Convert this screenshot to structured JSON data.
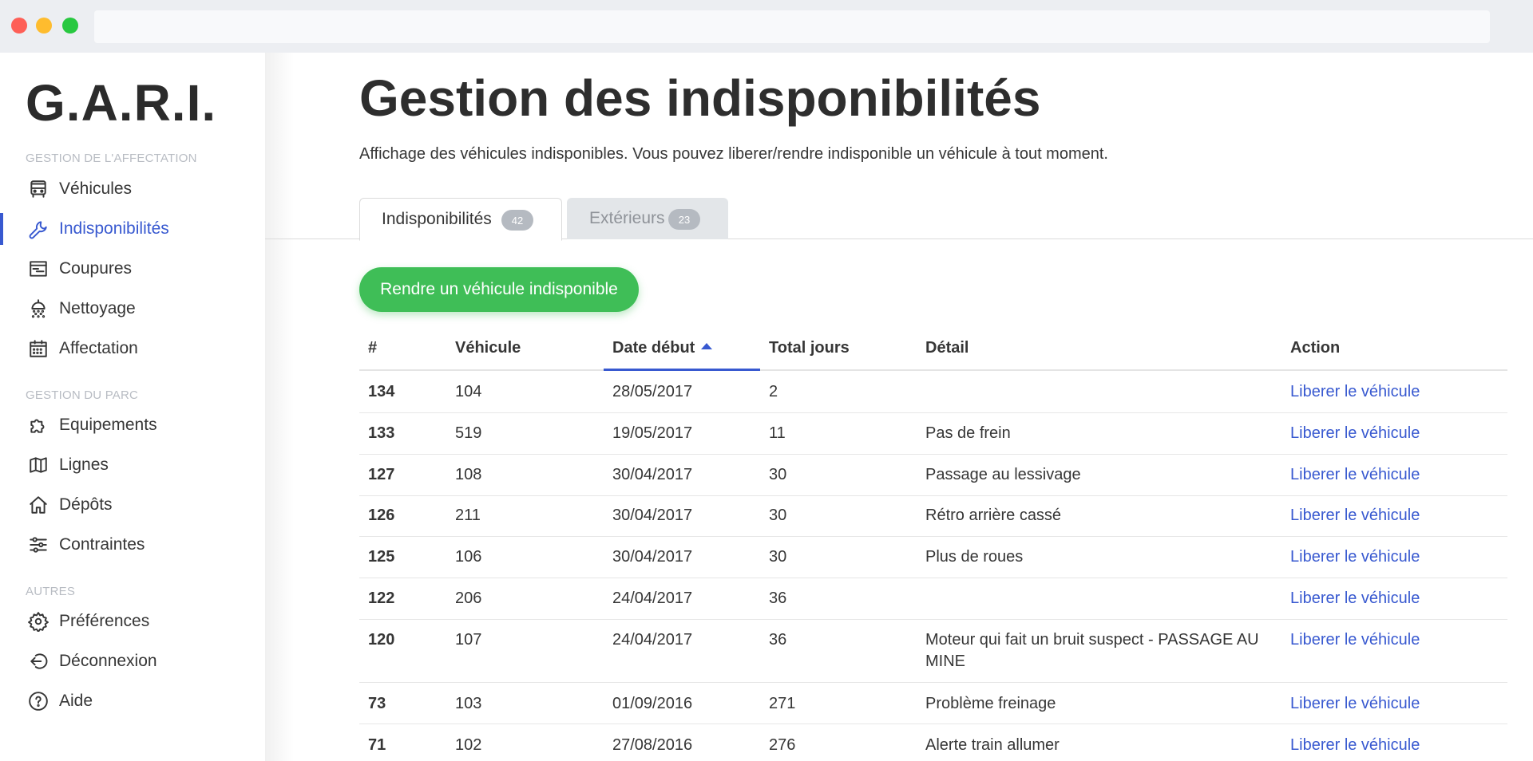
{
  "sidebar": {
    "logo": "G.A.R.I.",
    "sections": [
      {
        "label": "GESTION DE L'AFFECTATION"
      },
      {
        "label": "GESTION DU PARC"
      },
      {
        "label": "AUTRES"
      }
    ],
    "items": [
      {
        "label": "Véhicules",
        "icon": "bus-icon"
      },
      {
        "label": "Indisponibilités",
        "icon": "wrench-icon",
        "active": true
      },
      {
        "label": "Coupures",
        "icon": "list-box-icon"
      },
      {
        "label": "Nettoyage",
        "icon": "shower-icon"
      },
      {
        "label": "Affectation",
        "icon": "calendar-icon"
      },
      {
        "label": "Equipements",
        "icon": "puzzle-icon"
      },
      {
        "label": "Lignes",
        "icon": "map-icon"
      },
      {
        "label": "Dépôts",
        "icon": "home-icon"
      },
      {
        "label": "Contraintes",
        "icon": "sliders-icon"
      },
      {
        "label": "Préférences",
        "icon": "gear-icon"
      },
      {
        "label": "Déconnexion",
        "icon": "logout-icon"
      },
      {
        "label": "Aide",
        "icon": "help-icon"
      }
    ]
  },
  "header": {
    "title": "Gestion des indisponibilités",
    "subtitle": "Affichage des véhicules indisponibles. Vous pouvez liberer/rendre indisponible un véhicule à tout moment."
  },
  "tabs": [
    {
      "label": "Indisponibilités",
      "count": "42",
      "active": true
    },
    {
      "label": "Extérieurs",
      "count": "23",
      "active": false
    }
  ],
  "cta_label": "Rendre un véhicule indisponible",
  "table": {
    "columns": [
      "#",
      "Véhicule",
      "Date début",
      "Total jours",
      "Détail",
      "Action"
    ],
    "sorted_column": "Date début",
    "rows": [
      {
        "id": "134",
        "vehicle": "104",
        "date": "28/05/2017",
        "days": "2",
        "detail": "",
        "action": "Liberer le véhicule"
      },
      {
        "id": "133",
        "vehicle": "519",
        "date": "19/05/2017",
        "days": "11",
        "detail": "Pas de frein",
        "action": "Liberer le véhicule"
      },
      {
        "id": "127",
        "vehicle": "108",
        "date": "30/04/2017",
        "days": "30",
        "detail": "Passage au lessivage",
        "action": "Liberer le véhicule"
      },
      {
        "id": "126",
        "vehicle": "211",
        "date": "30/04/2017",
        "days": "30",
        "detail": "Rétro arrière cassé",
        "action": "Liberer le véhicule"
      },
      {
        "id": "125",
        "vehicle": "106",
        "date": "30/04/2017",
        "days": "30",
        "detail": "Plus de roues",
        "action": "Liberer le véhicule"
      },
      {
        "id": "122",
        "vehicle": "206",
        "date": "24/04/2017",
        "days": "36",
        "detail": "",
        "action": "Liberer le véhicule"
      },
      {
        "id": "120",
        "vehicle": "107",
        "date": "24/04/2017",
        "days": "36",
        "detail": "Moteur qui fait un bruit suspect - PASSAGE AU MINE",
        "action": "Liberer le véhicule"
      },
      {
        "id": "73",
        "vehicle": "103",
        "date": "01/09/2016",
        "days": "271",
        "detail": "Problème freinage",
        "action": "Liberer le véhicule"
      },
      {
        "id": "71",
        "vehicle": "102",
        "date": "27/08/2016",
        "days": "276",
        "detail": "Alerte train allumer",
        "action": "Liberer le véhicule"
      }
    ]
  },
  "colors": {
    "accent": "#3859d0",
    "cta": "#3fbe57"
  }
}
